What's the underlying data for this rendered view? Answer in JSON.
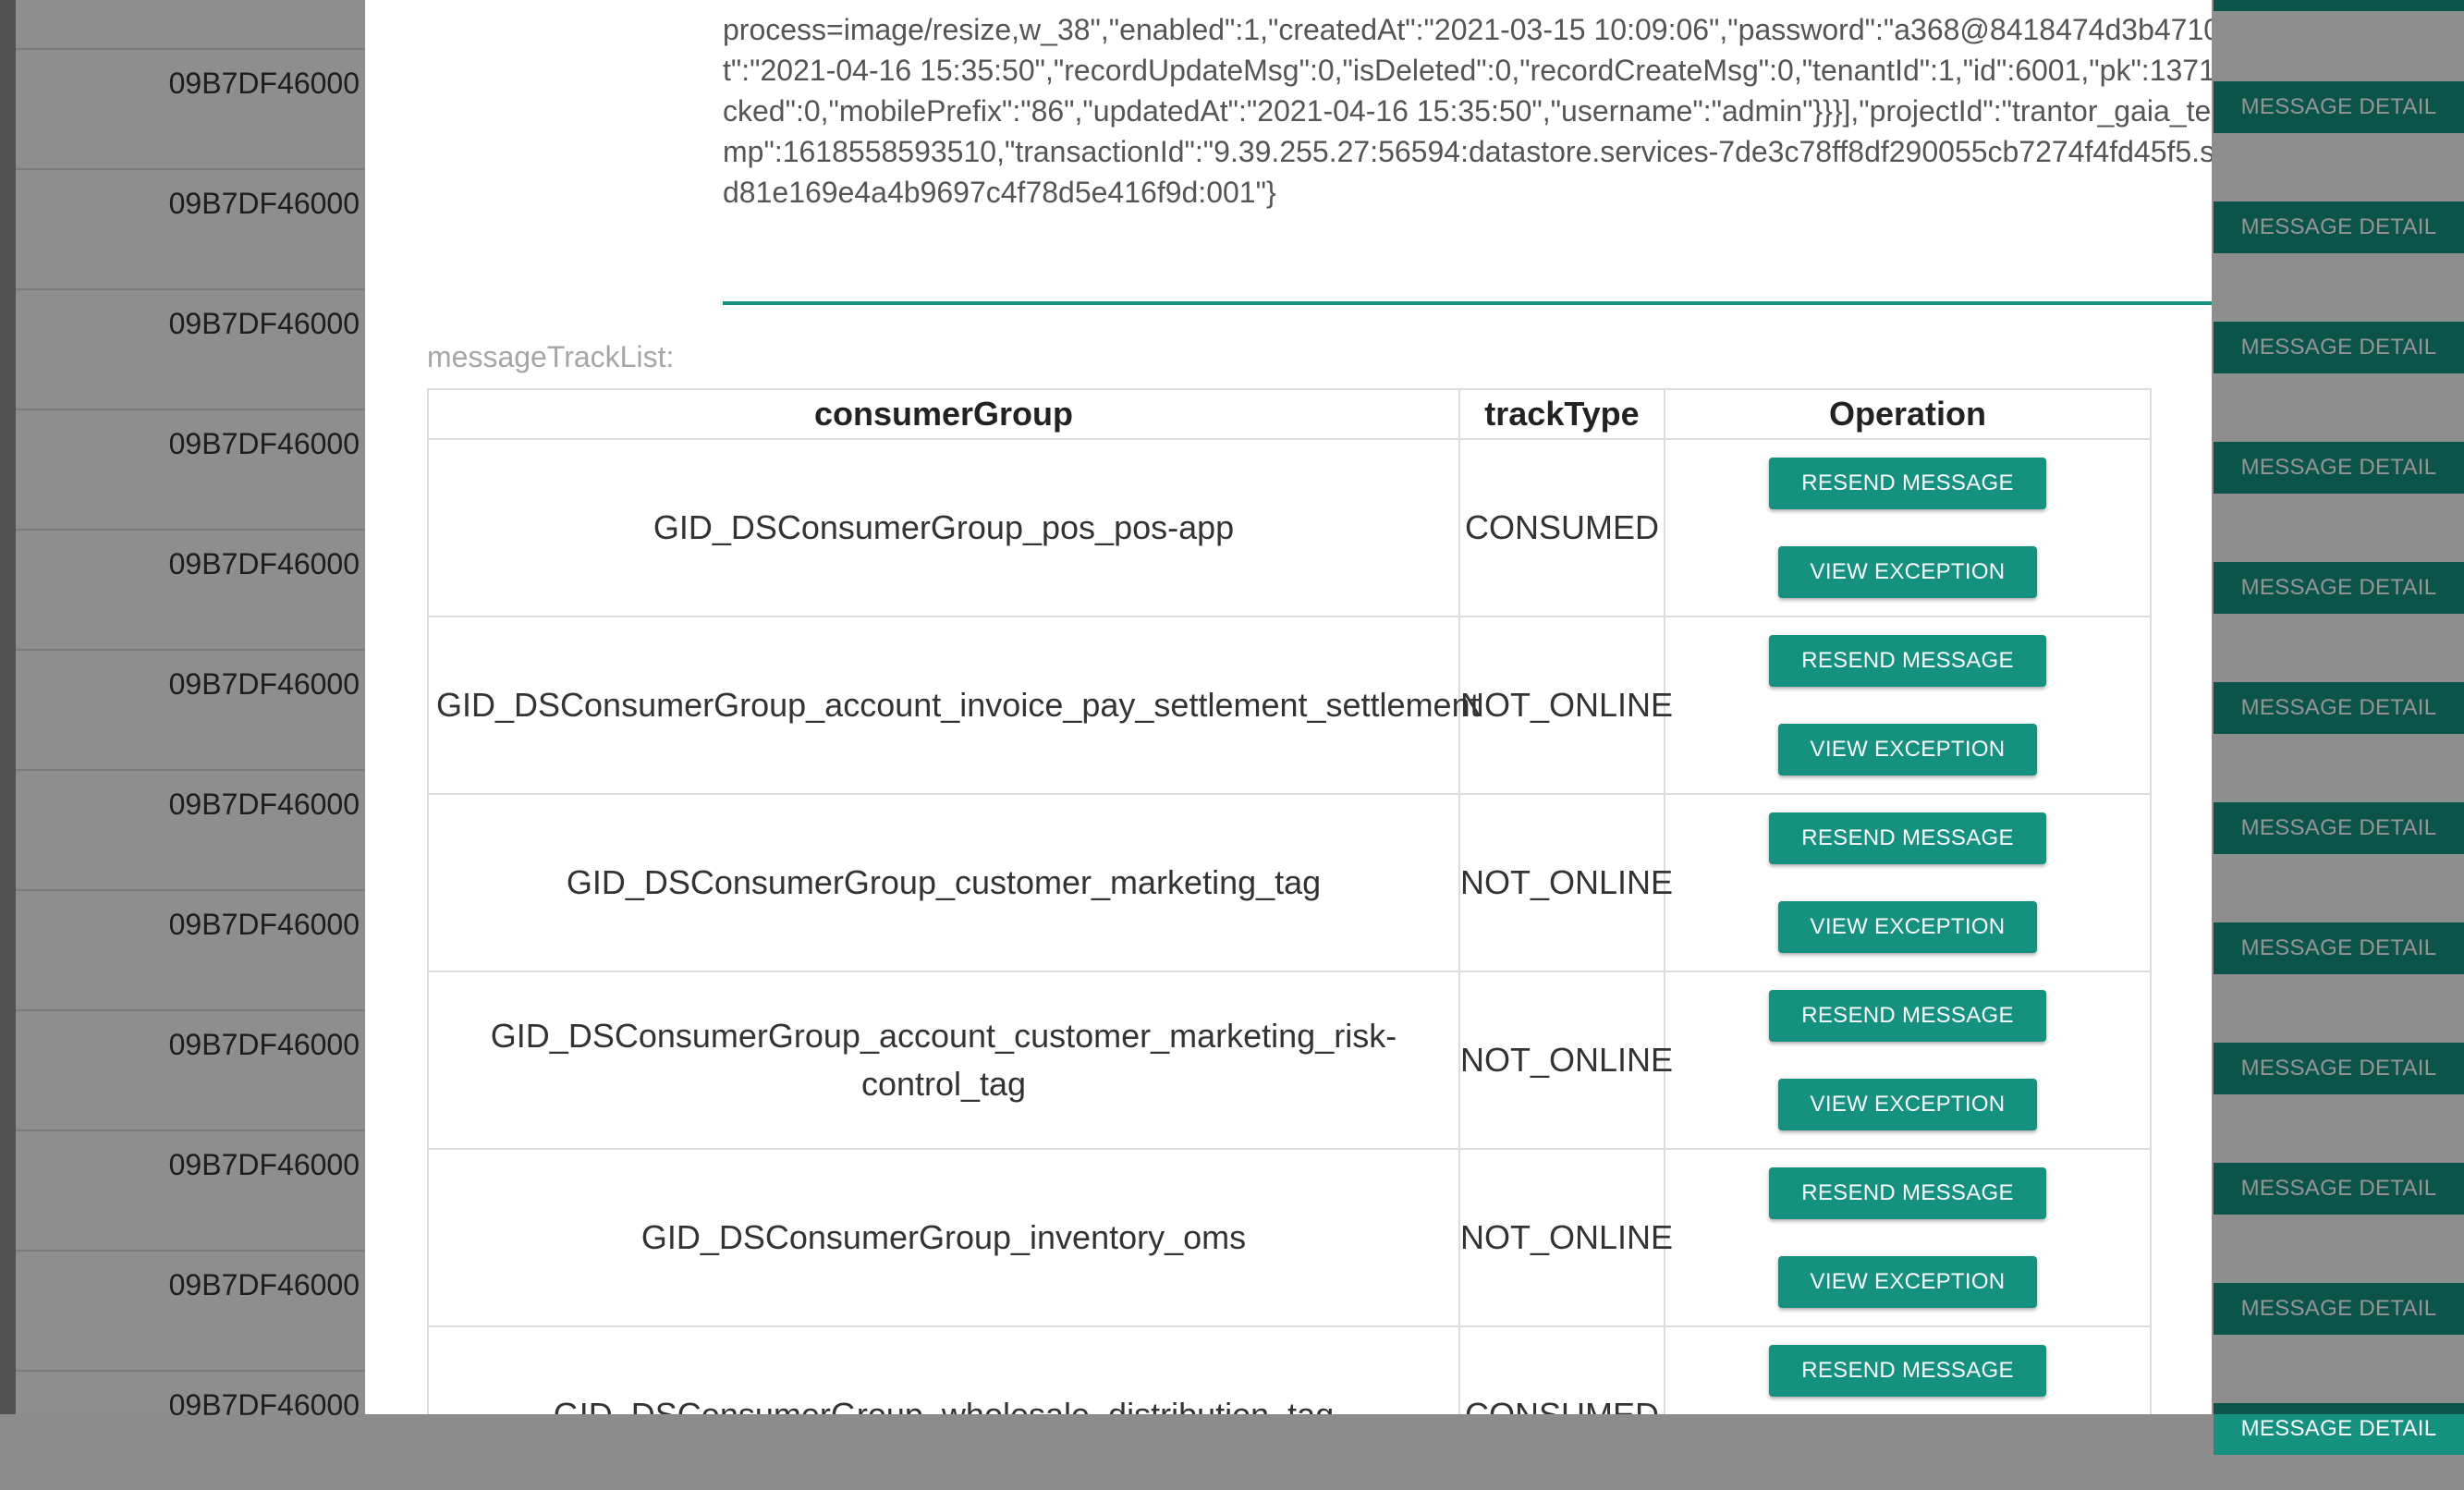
{
  "background_list": {
    "message_ids": [
      "09B7DF46000",
      "09B7DF46000",
      "09B7DF46000",
      "09B7DF46000",
      "09B7DF46000",
      "09B7DF46000",
      "09B7DF46000",
      "09B7DF46000",
      "09B7DF46000",
      "09B7DF46000",
      "09B7DF46000",
      "09B7DF46000"
    ],
    "detail_button_label": "MESSAGE DETAIL"
  },
  "modal": {
    "link_snippet": "",
    "message_body": "process=image/resize,w_38\",\"enabled\":1,\"createdAt\":\"2021-03-15 10:09:06\",\"password\":\"a368@8418474d3b471022a481\",\"lastLoginAt\":\"2021-04-16 15:35:50\",\"recordUpdateMsg\":0,\"isDeleted\":0,\"recordCreateMsg\":0,\"tenantId\":1,\"id\":6001,\"pk\":1371282275869720576,\"locked\":0,\"mobilePrefix\":\"86\",\"updatedAt\":\"2021-04-16 15:35:50\",\"username\":\"admin\"}}}],\"projectId\":\"trantor_gaia_test\",\"reqId\":null,\"timestamp\":1618558593510,\"transactionId\":\"9.39.255.27:56594:datastore.services-7de3c78ff8df290055cb7274f4fd45f5.svc.cluster.local:8080:4fd81e169e4a4b9697c4f78d5e416f9d:001\"}",
    "track_list_label": "messageTrackList:",
    "table": {
      "headers": [
        "consumerGroup",
        "trackType",
        "Operation"
      ],
      "rows": [
        {
          "consumer_group": "GID_DSConsumerGroup_pos_pos-app",
          "track_type": "CONSUMED"
        },
        {
          "consumer_group": "GID_DSConsumerGroup_account_invoice_pay_settlement_settlement",
          "track_type": "NOT_ONLINE"
        },
        {
          "consumer_group": "GID_DSConsumerGroup_customer_marketing_tag",
          "track_type": "NOT_ONLINE"
        },
        {
          "consumer_group": "GID_DSConsumerGroup_account_customer_marketing_risk-control_tag",
          "track_type": "NOT_ONLINE"
        },
        {
          "consumer_group": "GID_DSConsumerGroup_inventory_oms",
          "track_type": "NOT_ONLINE"
        },
        {
          "consumer_group": "GID_DSConsumerGroup_wholesale_distribution_tag",
          "track_type": "CONSUMED"
        }
      ],
      "resend_label": "RESEND MESSAGE",
      "exception_label": "VIEW EXCEPTION"
    }
  },
  "colors": {
    "accent": "#14917f",
    "overlay": "rgba(0,0,0,0.42)"
  }
}
